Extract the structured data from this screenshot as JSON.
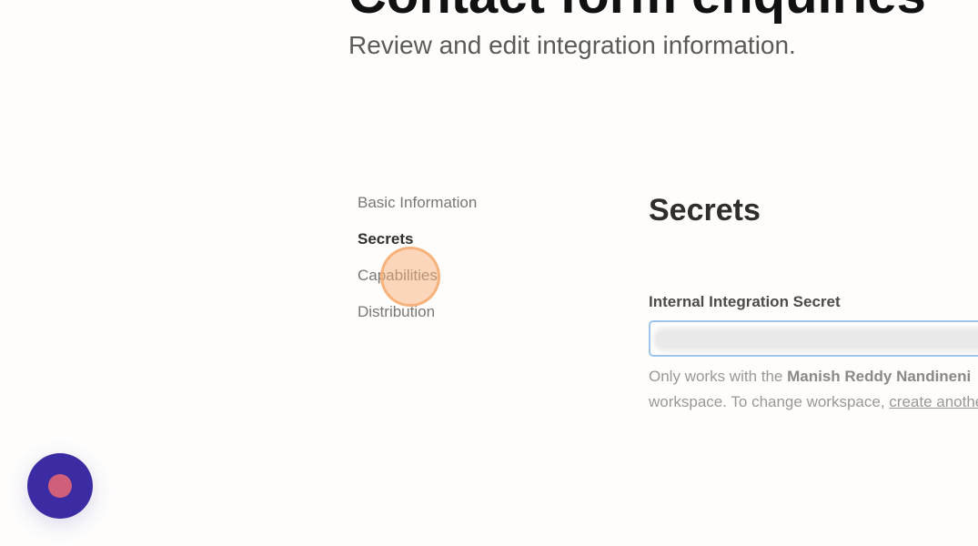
{
  "header": {
    "title": "Contact form enquiries",
    "subtitle": "Review and edit integration information."
  },
  "nav": {
    "items": [
      {
        "label": "Basic Information",
        "active": false
      },
      {
        "label": "Secrets",
        "active": true
      },
      {
        "label": "Capabilities",
        "active": false
      },
      {
        "label": "Distribution",
        "active": false
      }
    ]
  },
  "secrets": {
    "title": "Secrets",
    "field_label": "Internal Integration Secret",
    "field_value_state": "blurred",
    "helper": {
      "prefix": "Only works with the ",
      "workspace_name": "Manish Reddy Nandineni",
      "line2_prefix": "workspace. To change workspace, ",
      "link_text": "create another"
    }
  },
  "overlay": {
    "click_indicator_color": "#f6aa6e",
    "fab_icon": "record-dot-icon",
    "fab_color": "#3b2ca4",
    "fab_dot_color": "#d06079"
  }
}
